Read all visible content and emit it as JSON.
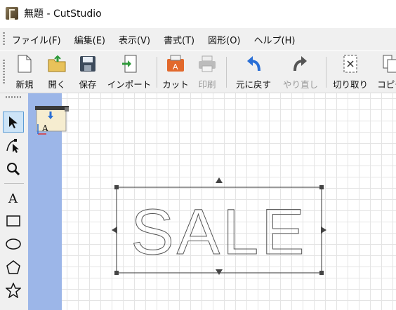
{
  "window": {
    "title": "無題 - CutStudio"
  },
  "menu": [
    "ファイル(F)",
    "編集(E)",
    "表示(V)",
    "書式(T)",
    "図形(O)",
    "ヘルプ(H)"
  ],
  "toolbar": {
    "new": "新規",
    "open": "開く",
    "save": "保存",
    "import": "インポート",
    "cut": "カット",
    "print": "印刷",
    "undo": "元に戻す",
    "redo": "やり直し",
    "trim": "切り取り",
    "copy": "コピー"
  },
  "canvas": {
    "text_object": "SALE"
  },
  "colors": {
    "canvas_strip": "#9cb6e8",
    "accent_blue": "#2a6fd6",
    "cut_orange": "#e2692c"
  }
}
